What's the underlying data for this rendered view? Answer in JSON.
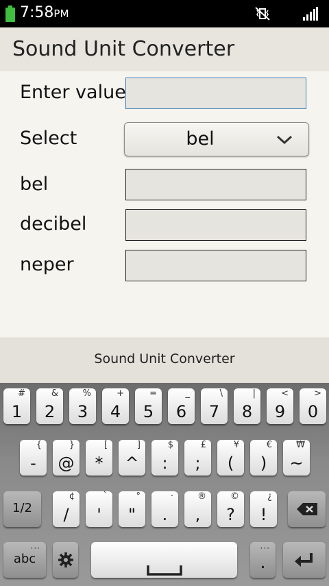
{
  "status_bar": {
    "time": "7:58",
    "ampm": "PM"
  },
  "app": {
    "title": "Sound Unit Converter"
  },
  "form": {
    "enter_label": "Enter value",
    "enter_value": "",
    "select_label": "Select",
    "select_value": "bel",
    "results": [
      {
        "label": "bel",
        "value": ""
      },
      {
        "label": "decibel",
        "value": ""
      },
      {
        "label": "neper",
        "value": ""
      }
    ]
  },
  "keyboard_title": "Sound Unit Converter",
  "keyboard": {
    "row1": [
      {
        "main": "1",
        "sub": "#"
      },
      {
        "main": "2",
        "sub": "&"
      },
      {
        "main": "3",
        "sub": "%"
      },
      {
        "main": "4",
        "sub": "+"
      },
      {
        "main": "5",
        "sub": "="
      },
      {
        "main": "6",
        "sub": "_"
      },
      {
        "main": "7",
        "sub": "\\"
      },
      {
        "main": "8",
        "sub": "|"
      },
      {
        "main": "9",
        "sub": "<"
      },
      {
        "main": "0",
        "sub": ">"
      }
    ],
    "row2": [
      {
        "main": "-",
        "sub": "{"
      },
      {
        "main": "@",
        "sub": "}"
      },
      {
        "main": "*",
        "sub": "["
      },
      {
        "main": "^",
        "sub": "]"
      },
      {
        "main": ":",
        "sub": "$"
      },
      {
        "main": ";",
        "sub": "£"
      },
      {
        "main": "(",
        "sub": "¥"
      },
      {
        "main": ")",
        "sub": "€"
      },
      {
        "main": "~",
        "sub": "₩"
      }
    ],
    "row3_shift": "1/2",
    "row3": [
      {
        "main": "/",
        "sub": "¢"
      },
      {
        "main": "'",
        "sub": "`"
      },
      {
        "main": "\"",
        "sub": "°"
      },
      {
        "main": ".",
        "sub": "·"
      },
      {
        "main": ",",
        "sub": "®"
      },
      {
        "main": "?",
        "sub": "©"
      },
      {
        "main": "!",
        "sub": "¿"
      }
    ],
    "abc_label": "abc",
    "period": "."
  },
  "colors": {
    "input_border": "#3a7ab8",
    "battery": "#3fbf3f"
  }
}
